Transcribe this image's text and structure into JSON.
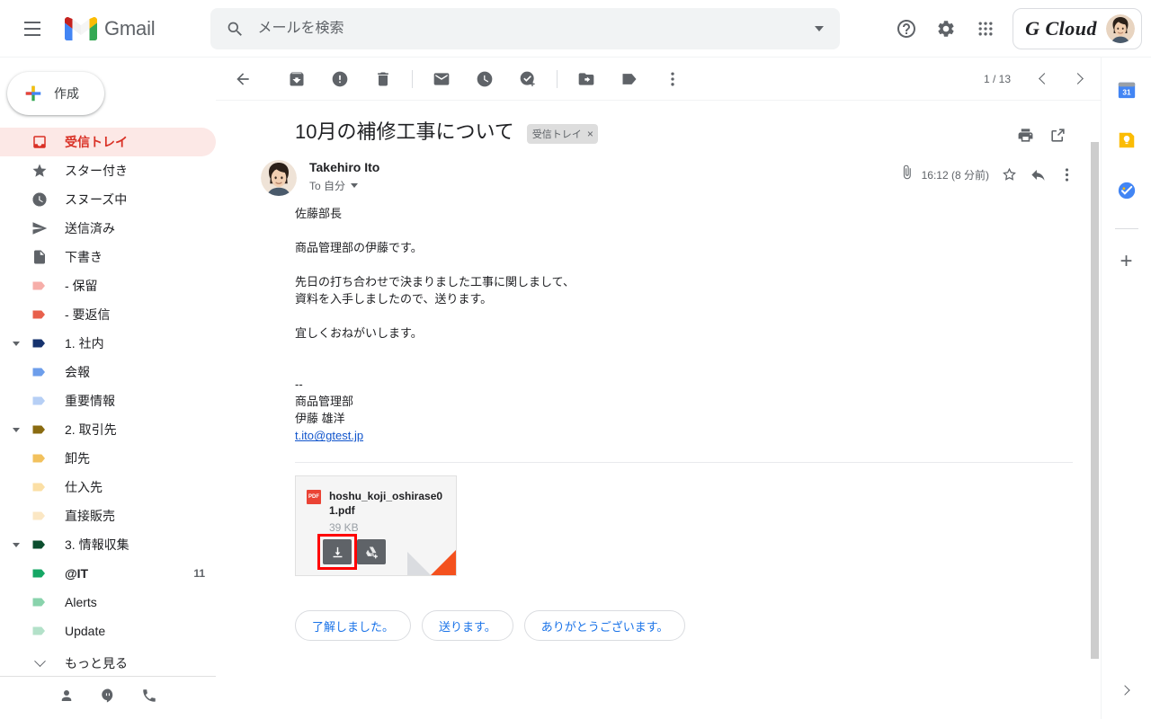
{
  "topbar": {
    "menu_icon": "hamburger-menu-icon",
    "brand": "Gmail",
    "search": {
      "placeholder": "メールを検索",
      "value": "",
      "icon": "search-icon",
      "options_icon": "chevron-down-icon"
    },
    "help_icon": "help-icon",
    "settings_icon": "gear-icon",
    "apps_icon": "apps-grid-icon",
    "account": {
      "name": "G Cloud",
      "avatar_icon": "user-avatar"
    }
  },
  "sidebar": {
    "compose": {
      "label": "作成",
      "icon": "plus-icon"
    },
    "items": [
      {
        "label": "受信トレイ",
        "icon": "inbox-icon",
        "active": true,
        "count": "",
        "level": 0,
        "twisty": "none",
        "color": "#d93025"
      },
      {
        "label": "スター付き",
        "icon": "star-icon",
        "active": false,
        "count": "",
        "level": 0,
        "twisty": "none",
        "color": "#5f6368"
      },
      {
        "label": "スヌーズ中",
        "icon": "clock-icon",
        "active": false,
        "count": "",
        "level": 0,
        "twisty": "none",
        "color": "#5f6368"
      },
      {
        "label": "送信済み",
        "icon": "send-icon",
        "active": false,
        "count": "",
        "level": 0,
        "twisty": "none",
        "color": "#5f6368"
      },
      {
        "label": "下書き",
        "icon": "draft-icon",
        "active": false,
        "count": "",
        "level": 0,
        "twisty": "none",
        "color": "#5f6368"
      },
      {
        "label": "- 保留",
        "icon": "label-tag-icon",
        "active": false,
        "count": "",
        "level": 0,
        "twisty": "none",
        "color": "#f6aea9"
      },
      {
        "label": "- 要返信",
        "icon": "label-tag-icon",
        "active": false,
        "count": "",
        "level": 0,
        "twisty": "none",
        "color": "#e8604c"
      },
      {
        "label": "1. 社内",
        "icon": "label-tag-icon",
        "active": false,
        "count": "",
        "level": 0,
        "twisty": "expanded",
        "color": "#16336e"
      },
      {
        "label": "会報",
        "icon": "label-tag-icon",
        "active": false,
        "count": "",
        "level": 1,
        "twisty": "none",
        "color": "#6d9eeb"
      },
      {
        "label": "重要情報",
        "icon": "label-tag-icon",
        "active": false,
        "count": "",
        "level": 1,
        "twisty": "none",
        "color": "#b6cff5"
      },
      {
        "label": "2. 取引先",
        "icon": "label-tag-icon",
        "active": false,
        "count": "",
        "level": 0,
        "twisty": "expanded",
        "color": "#8a6b10"
      },
      {
        "label": "卸先",
        "icon": "label-tag-icon",
        "active": false,
        "count": "",
        "level": 1,
        "twisty": "none",
        "color": "#f2c15d"
      },
      {
        "label": "仕入先",
        "icon": "label-tag-icon",
        "active": false,
        "count": "",
        "level": 1,
        "twisty": "none",
        "color": "#fbdfa5"
      },
      {
        "label": "直接販売",
        "icon": "label-tag-icon",
        "active": false,
        "count": "",
        "level": 1,
        "twisty": "none",
        "color": "#fbe7c4"
      },
      {
        "label": "3. 情報収集",
        "icon": "label-tag-icon",
        "active": false,
        "count": "",
        "level": 0,
        "twisty": "expanded",
        "color": "#0b4e2e"
      },
      {
        "label": "@IT",
        "icon": "label-tag-icon",
        "active": false,
        "count": "11",
        "level": 1,
        "twisty": "none",
        "color": "#16a765",
        "bold": true
      },
      {
        "label": "Alerts",
        "icon": "label-tag-icon",
        "active": false,
        "count": "",
        "level": 1,
        "twisty": "none",
        "color": "#89d3ac"
      },
      {
        "label": "Update",
        "icon": "label-tag-icon",
        "active": false,
        "count": "",
        "level": 1,
        "twisty": "none",
        "color": "#b3e1c9"
      },
      {
        "label": "もっと見る",
        "icon": "chevron-down-icon",
        "active": false,
        "count": "",
        "level": 0,
        "twisty": "more",
        "color": "#5f6368"
      }
    ],
    "footer_icons": [
      "contacts-icon",
      "hangouts-icon",
      "phone-icon"
    ]
  },
  "toolbar": {
    "back_icon": "back-arrow-icon",
    "archive_icon": "archive-icon",
    "spam_icon": "report-spam-icon",
    "delete_icon": "trash-icon",
    "unread_icon": "mark-unread-icon",
    "snooze_icon": "snooze-clock-icon",
    "task_icon": "add-to-tasks-icon",
    "move_icon": "move-to-folder-icon",
    "label_icon": "labels-icon",
    "more_icon": "more-vertical-icon",
    "pagination": "1 / 13",
    "prev_icon": "chevron-left-icon",
    "next_icon": "chevron-right-icon"
  },
  "thread": {
    "subject": "10月の補修工事について",
    "label_chip": "受信トレイ",
    "label_chip_remove": "×",
    "print_icon": "print-icon",
    "popout_icon": "open-in-new-icon",
    "message": {
      "sender": "Takehiro Ito",
      "to_line": "To 自分",
      "attachment_icon": "paperclip-icon",
      "time": "16:12 (8 分前)",
      "star_icon": "star-outline-icon",
      "reply_icon": "reply-icon",
      "more_icon": "more-vertical-icon",
      "body": "佐藤部長\n\n商品管理部の伊藤です。\n\n先日の打ち合わせで決まりました工事に関しまして、\n資料を入手しましたので、送ります。\n\n宜しくおねがいします。\n\n\n--\n商品管理部\n伊藤 雄洋\n",
      "body_email": "t.ito@gtest.jp"
    },
    "attachment": {
      "type_badge": "PDF",
      "filename": "hoshu_koji_oshirase01.pdf",
      "size": "39 KB",
      "download_icon": "download-icon",
      "drive_icon": "add-to-drive-icon",
      "highlight_color": "#ff0000"
    },
    "smart_replies": [
      "了解しました。",
      "送ります。",
      "ありがとうございます。"
    ]
  },
  "addon_rail": {
    "items": [
      {
        "icon": "google-calendar-icon",
        "label": "31"
      },
      {
        "icon": "google-keep-icon",
        "label": ""
      },
      {
        "icon": "google-tasks-icon",
        "label": ""
      }
    ],
    "add_icon": "plus-icon",
    "expand_icon": "chevron-right-icon"
  },
  "colors": {
    "accent_red": "#d93025",
    "link_blue": "#1a73e8",
    "inbox_bg": "#fce8e6",
    "highlight": "#ff0000"
  }
}
